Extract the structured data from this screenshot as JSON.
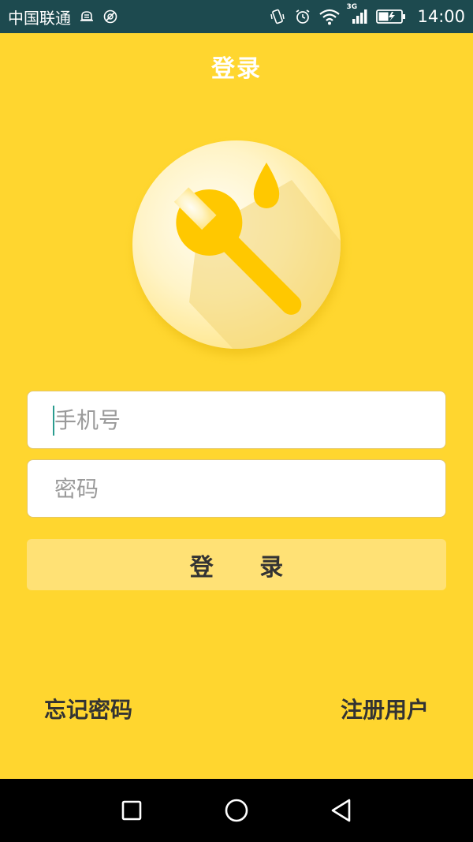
{
  "status_bar": {
    "carrier": "中国联通",
    "time": "14:00",
    "network": "3G"
  },
  "header": {
    "title": "登录"
  },
  "logo": {
    "icon": "wrench-oil-drop-icon"
  },
  "form": {
    "phone_placeholder": "手机号",
    "password_placeholder": "密码",
    "login_label": "登 录"
  },
  "links": {
    "forgot_password": "忘记密码",
    "register": "注册用户"
  },
  "navbar": {
    "recent_icon": "square-icon",
    "home_icon": "circle-icon",
    "back_icon": "triangle-back-icon"
  },
  "colors": {
    "background": "#FFD62F",
    "status_bar": "#1D4A4F",
    "button": "#FFE175",
    "accent": "#FFC800"
  }
}
